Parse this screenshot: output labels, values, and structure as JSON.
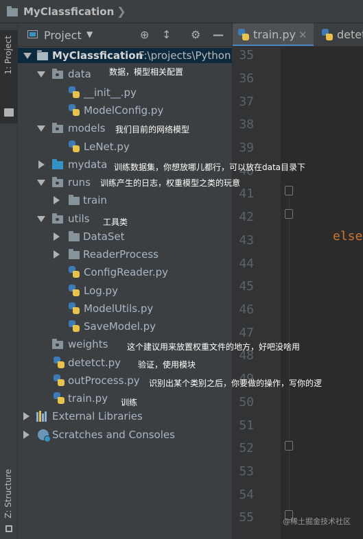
{
  "window": {
    "title": "MyClassfication"
  },
  "left_strip": {
    "project_label": "1: Project",
    "structure_label": "Z: Structure"
  },
  "panel": {
    "label": "Project"
  },
  "tree": {
    "root": {
      "name": "MyClassfication",
      "path": "F:\\projects\\Python"
    },
    "items": [
      {
        "name": "data",
        "type": "folder"
      },
      {
        "name": "__init__.py",
        "type": "py"
      },
      {
        "name": "ModelConfig.py",
        "type": "py"
      },
      {
        "name": "models",
        "type": "folder"
      },
      {
        "name": "LeNet.py",
        "type": "py"
      },
      {
        "name": "mydata",
        "type": "folder-blue"
      },
      {
        "name": "runs",
        "type": "folder"
      },
      {
        "name": "train",
        "type": "folder"
      },
      {
        "name": "utils",
        "type": "folder"
      },
      {
        "name": "DataSet",
        "type": "folder"
      },
      {
        "name": "ReaderProcess",
        "type": "folder"
      },
      {
        "name": "ConfigReader.py",
        "type": "py"
      },
      {
        "name": "Log.py",
        "type": "py"
      },
      {
        "name": "ModelUtils.py",
        "type": "py"
      },
      {
        "name": "SaveModel.py",
        "type": "py"
      },
      {
        "name": "weights",
        "type": "folder"
      },
      {
        "name": "detetct.py",
        "type": "py"
      },
      {
        "name": "outProcess.py",
        "type": "py"
      },
      {
        "name": "train.py",
        "type": "py"
      },
      {
        "name": "External Libraries",
        "type": "lib"
      },
      {
        "name": "Scratches and Consoles",
        "type": "scratch"
      }
    ]
  },
  "notes": {
    "data": "数据，模型相关配置",
    "models": "我们目前的网络模型",
    "mydata": "训练数据集，你想放哪儿都行，可以放在data目录下",
    "runs": "训练产生的日志，权重模型之类的玩意",
    "utils": "工具类",
    "weights": "这个建议用来放置权重文件的地方，好吧没啥用",
    "detetct": "验证，使用模块",
    "outProcess": "识别出某个类别之后，你要做的操作，写你的逻",
    "train": "训练"
  },
  "editor": {
    "tabs": [
      {
        "label": "train.py"
      },
      {
        "label": "detet"
      }
    ],
    "line_numbers": [
      "35",
      "36",
      "37",
      "38",
      "39",
      "40",
      "41",
      "42",
      "43",
      "44",
      "45",
      "46",
      "47",
      "48",
      "49",
      "50",
      "51",
      "52",
      "53",
      "54",
      "55"
    ],
    "keyword": "else"
  },
  "watermark": "@稀土掘金技术社区"
}
